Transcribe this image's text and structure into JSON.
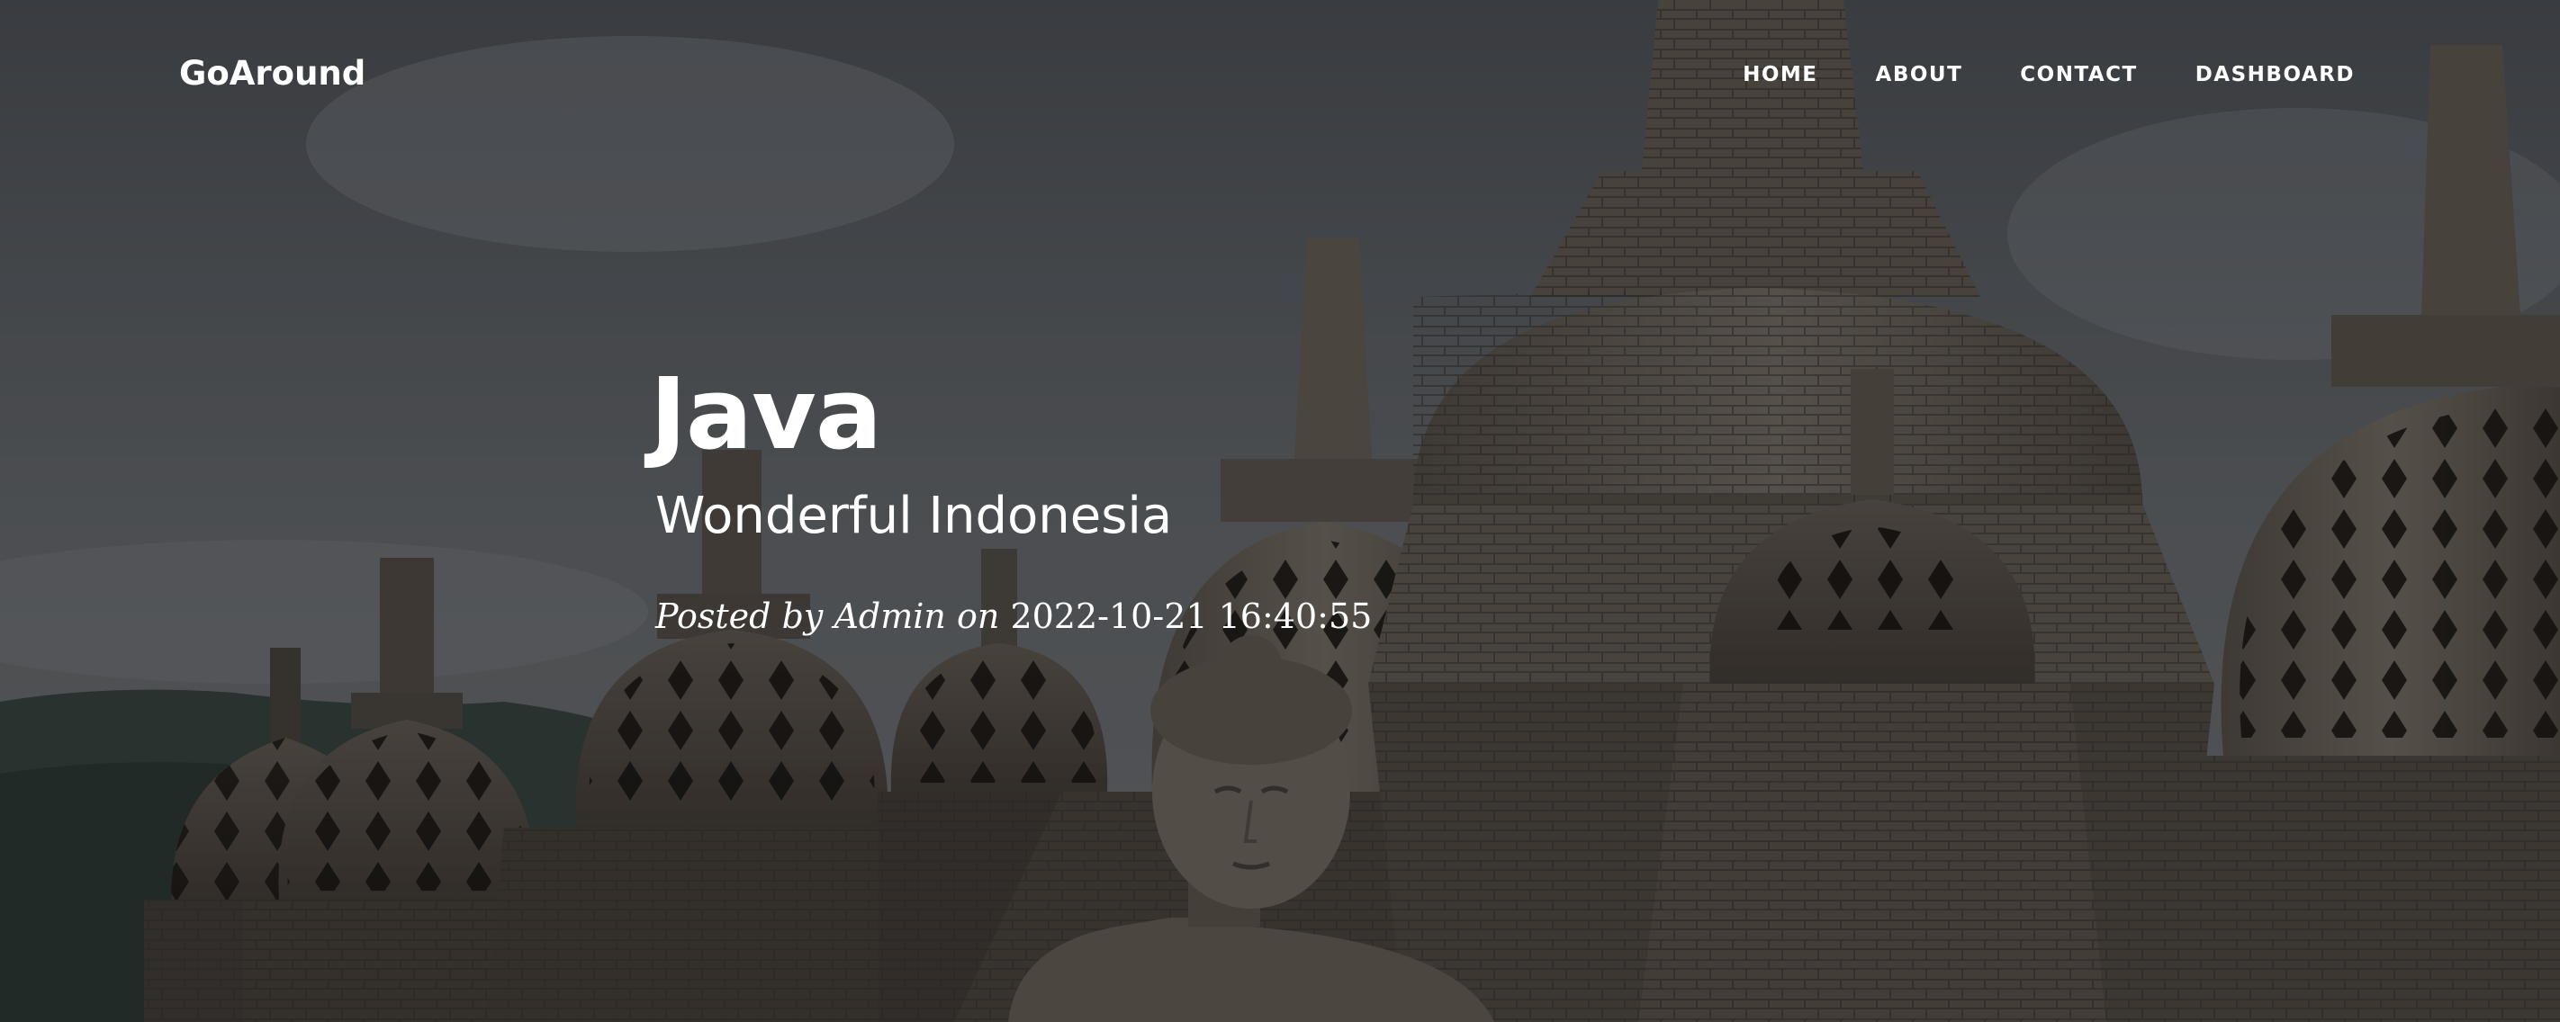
{
  "site": {
    "brand": "GoAround"
  },
  "nav": {
    "items": [
      {
        "label": "HOME"
      },
      {
        "label": "ABOUT"
      },
      {
        "label": "CONTACT"
      },
      {
        "label": "DASHBOARD"
      }
    ]
  },
  "post": {
    "title": "Java",
    "subtitle": "Wonderful Indonesia",
    "meta_prefix": "Posted by",
    "author": "Admin",
    "meta_on": "on",
    "datetime": "2022-10-21 16:40:55"
  },
  "colors": {
    "text": "#ffffff",
    "overlay": "#000000"
  }
}
